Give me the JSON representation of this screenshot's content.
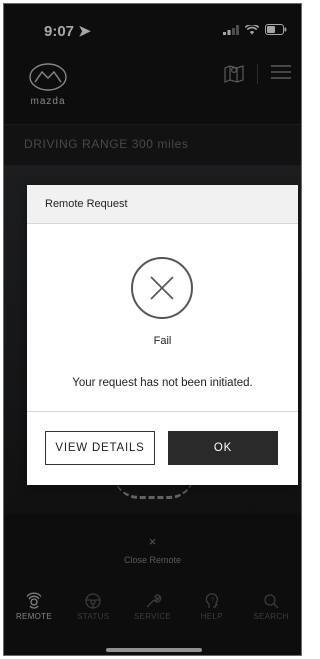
{
  "status_bar": {
    "time": "9:07"
  },
  "header": {
    "logo_text": "mazda"
  },
  "range": {
    "text": "DRIVING RANGE 300 miles"
  },
  "close_remote": {
    "icon": "×",
    "label": "Close Remote"
  },
  "bottom_nav": {
    "items": [
      {
        "label": "REMOTE",
        "icon": "remote-icon",
        "active": true
      },
      {
        "label": "STATUS",
        "icon": "steering-wheel-icon",
        "active": false
      },
      {
        "label": "SERVICE",
        "icon": "wrench-icon",
        "active": false
      },
      {
        "label": "HELP",
        "icon": "help-head-icon",
        "active": false
      },
      {
        "label": "SEARCH",
        "icon": "search-icon",
        "active": false
      }
    ]
  },
  "modal": {
    "title": "Remote Request",
    "status": "Fail",
    "message": "Your request has not been initiated.",
    "details_button": "VIEW DETAILS",
    "ok_button": "OK"
  }
}
